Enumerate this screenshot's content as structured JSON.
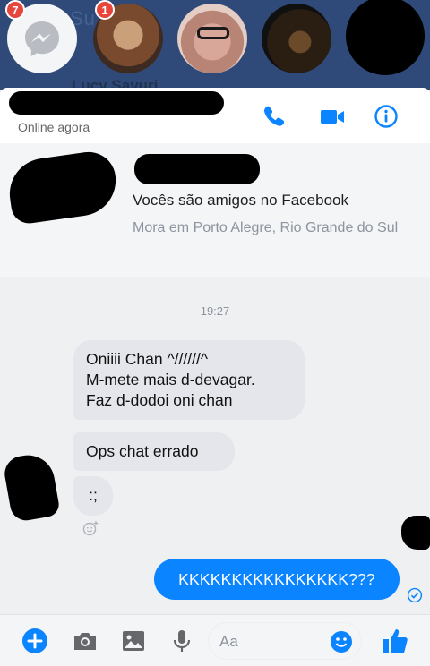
{
  "chat_heads": {
    "messenger_badge": "7",
    "friend_badge": "1",
    "faded_name": "Lucy Sayuri"
  },
  "header": {
    "status": "Online agora"
  },
  "profile": {
    "friends_text": "Vocês são amigos no Facebook",
    "lives_text": "Mora em Porto Alegre, Rio Grande do Sul"
  },
  "conversation": {
    "timestamp": "19:27",
    "incoming": [
      {
        "lines": [
          "Oniiii Chan ^//////^",
          "M-mete mais d-devagar.",
          "Faz d-dodoi oni chan"
        ]
      },
      {
        "lines": [
          "Ops chat errado"
        ]
      },
      {
        "lines": [
          ":;"
        ]
      }
    ],
    "outgoing": [
      {
        "text": "KKKKKKKKKKKKKKKK???"
      }
    ]
  },
  "composer": {
    "placeholder": "Aa"
  },
  "colors": {
    "accent": "#0a84ff",
    "incoming_bubble": "#e4e6eb",
    "badge": "#e8453c"
  }
}
